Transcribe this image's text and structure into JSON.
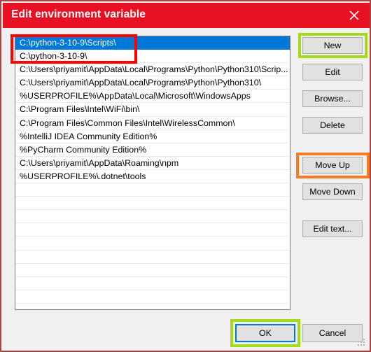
{
  "window": {
    "title": "Edit environment variable",
    "close_icon": "close-icon",
    "titlebar_color": "#e81123",
    "border_color": "#a94442"
  },
  "list": {
    "selected_index": 0,
    "selection_color": "#0078d7",
    "items": [
      "C:\\python-3-10-9\\Scripts\\",
      "C:\\python-3-10-9\\",
      "C:\\Users\\priyamit\\AppData\\Local\\Programs\\Python\\Python310\\Scrip...",
      "C:\\Users\\priyamit\\AppData\\Local\\Programs\\Python\\Python310\\",
      "%USERPROFILE%\\AppData\\Local\\Microsoft\\WindowsApps",
      "C:\\Program Files\\Intel\\WiFi\\bin\\",
      "C:\\Program Files\\Common Files\\Intel\\WirelessCommon\\",
      "%IntelliJ IDEA Community Edition%",
      "%PyCharm Community Edition%",
      "C:\\Users\\priyamit\\AppData\\Roaming\\npm",
      "%USERPROFILE%\\.dotnet\\tools"
    ],
    "empty_row_count": 9
  },
  "side_buttons": {
    "new": "New",
    "edit": "Edit",
    "browse": "Browse...",
    "delete": "Delete",
    "move_up": "Move Up",
    "move_down": "Move Down",
    "edit_text": "Edit text..."
  },
  "bottom_buttons": {
    "ok": "OK",
    "cancel": "Cancel"
  },
  "annotations": {
    "red_box_color": "#ff0000",
    "green_box_color": "#a6d91a",
    "orange_box_color": "#f57c20"
  }
}
